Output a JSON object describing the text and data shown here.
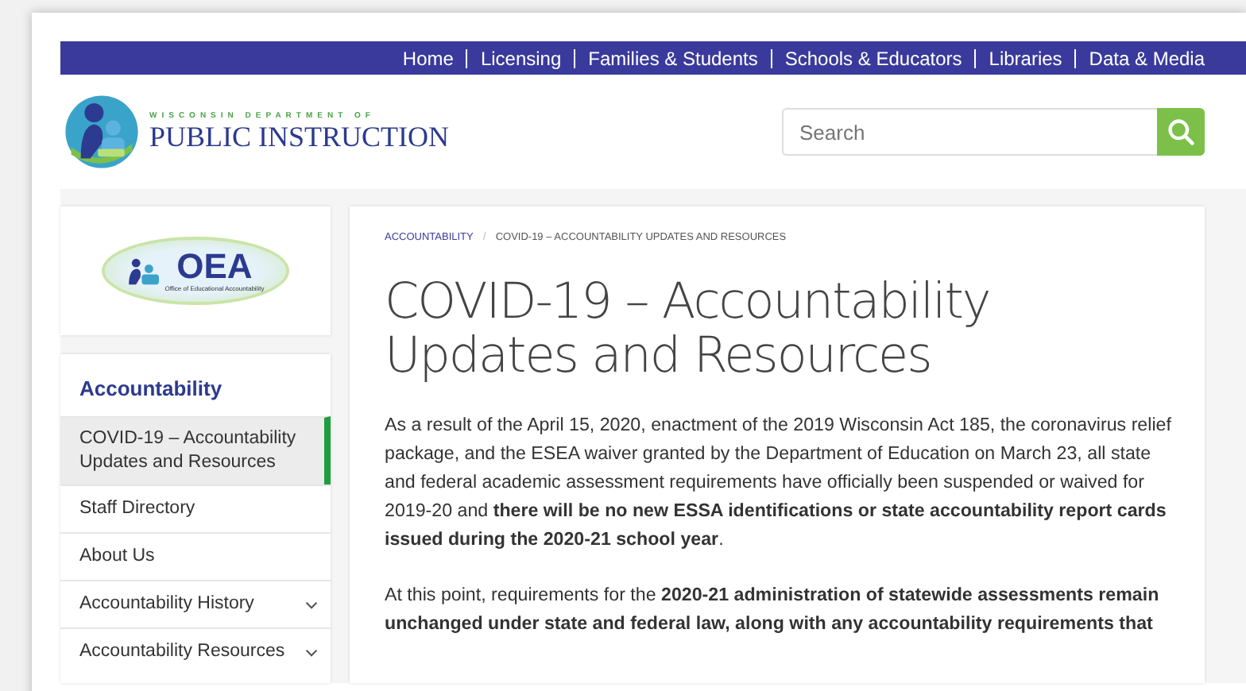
{
  "top_nav": [
    {
      "label": "Home"
    },
    {
      "label": "Licensing"
    },
    {
      "label": "Families & Students"
    },
    {
      "label": "Schools & Educators"
    },
    {
      "label": "Libraries"
    },
    {
      "label": "Data & Media"
    }
  ],
  "logo": {
    "overline": "WISCONSIN DEPARTMENT OF",
    "name": "PUBLIC INSTRUCTION"
  },
  "search": {
    "placeholder": "Search"
  },
  "office_logo": {
    "acronym": "OEA",
    "caption": "Office of Educational Accountability"
  },
  "sidebar": {
    "title": "Accountability",
    "items": [
      {
        "label": "COVID-19 – Accountability Updates and Resources",
        "selected": true,
        "expandable": false
      },
      {
        "label": "Staff Directory",
        "selected": false,
        "expandable": false
      },
      {
        "label": "About Us",
        "selected": false,
        "expandable": false
      },
      {
        "label": "Accountability History",
        "selected": false,
        "expandable": true
      },
      {
        "label": "Accountability Resources",
        "selected": false,
        "expandable": true
      }
    ]
  },
  "breadcrumb": {
    "separator": "/",
    "items": [
      {
        "label": "ACCOUNTABILITY"
      },
      {
        "label": "COVID-19 – ACCOUNTABILITY UPDATES AND RESOURCES"
      }
    ]
  },
  "page_title": "COVID-19 – Accountability Updates and Resources",
  "paragraphs": [
    "As a result of the April 15, 2020, enactment of the 2019 Wisconsin Act 185, the coronavirus relief package, and the ESEA waiver granted by the Department of Education on March 23, all state and federal academic assessment requirements have officially been suspended or waived for 2019-20 and **there will be no new ESSA identifications or state accountability report cards issued during the 2020-21 school year**.",
    "At this point, requirements for the **2020-21 administration of statewide assessments remain unchanged under state and federal law, along with any accountability requirements that**"
  ]
}
